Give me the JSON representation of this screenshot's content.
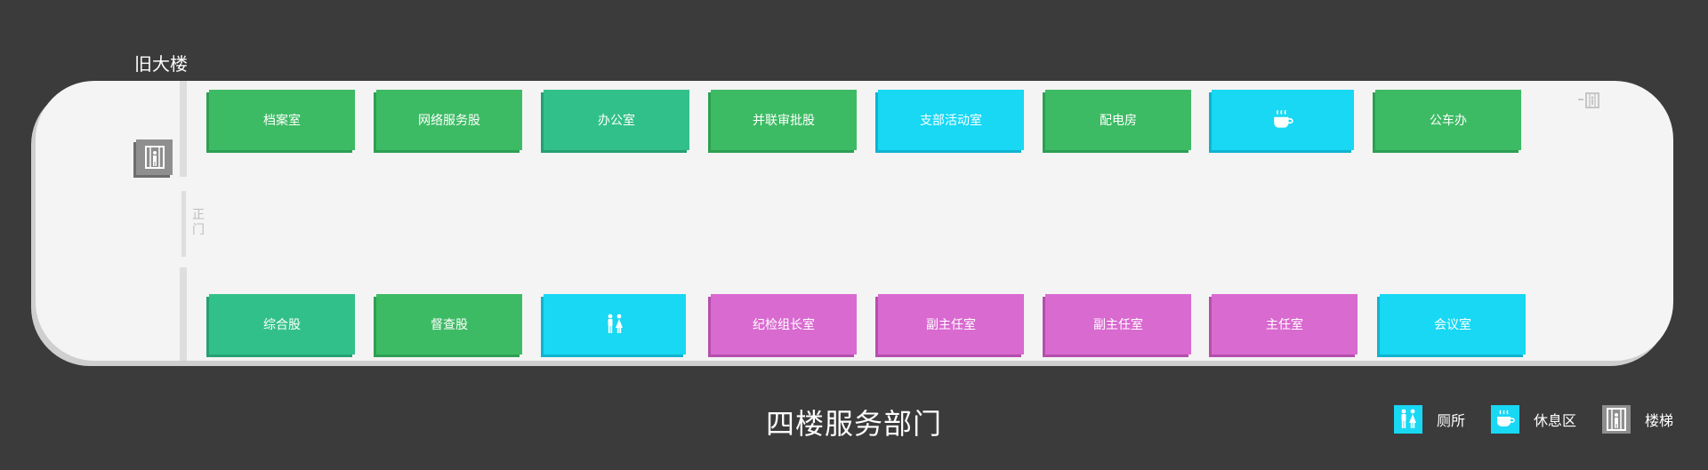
{
  "building": {
    "label": "旧大楼"
  },
  "entrance": {
    "label": "正门"
  },
  "title": "四楼服务部门",
  "colors": {
    "background": "#3b3b3b",
    "floor": "#f4f4f4",
    "green": "#3dbb64",
    "teal": "#32c08a",
    "cyan": "#18d8f4",
    "magenta": "#d96ad0",
    "stairs_gray": "#8f8f8f"
  },
  "rooms_top": [
    {
      "label": "档案室",
      "color": "#3dbb64",
      "shade": "#2d9f52"
    },
    {
      "label": "网络服务股",
      "color": "#3dbb64",
      "shade": "#2d9f52"
    },
    {
      "label": "办公室",
      "color": "#32c08a",
      "shade": "#25a073"
    },
    {
      "label": "并联审批股",
      "color": "#3dbb64",
      "shade": "#2d9f52"
    },
    {
      "label": "支部活动室",
      "color": "#18d8f4",
      "shade": "#10b3cf"
    },
    {
      "label": "配电房",
      "color": "#3dbb64",
      "shade": "#2d9f52"
    },
    {
      "label": "",
      "icon": "coffee-cup-icon",
      "color": "#18d8f4",
      "shade": "#10b3cf"
    },
    {
      "label": "公车办",
      "color": "#3dbb64",
      "shade": "#2d9f52"
    }
  ],
  "rooms_bottom": [
    {
      "label": "综合股",
      "color": "#32c08a",
      "shade": "#25a073"
    },
    {
      "label": "督查股",
      "color": "#3dbb64",
      "shade": "#2d9f52"
    },
    {
      "label": "",
      "icon": "restroom-icon",
      "color": "#18d8f4",
      "shade": "#10b3cf"
    },
    {
      "label": "纪检组长室",
      "color": "#d96ad0",
      "shade": "#b54fad"
    },
    {
      "label": "副主任室",
      "color": "#d96ad0",
      "shade": "#b54fad"
    },
    {
      "label": "副主任室",
      "color": "#d96ad0",
      "shade": "#b54fad"
    },
    {
      "label": "主任室",
      "color": "#d96ad0",
      "shade": "#b54fad"
    },
    {
      "label": "会议室",
      "color": "#18d8f4",
      "shade": "#10b3cf"
    }
  ],
  "legend": [
    {
      "label": "厕所",
      "icon": "restroom-icon",
      "color": "#18d8f4"
    },
    {
      "label": "休息区",
      "icon": "coffee-cup-icon",
      "color": "#18d8f4"
    },
    {
      "label": "楼梯",
      "icon": "stairs-icon",
      "color": "#8f8f8f"
    }
  ]
}
